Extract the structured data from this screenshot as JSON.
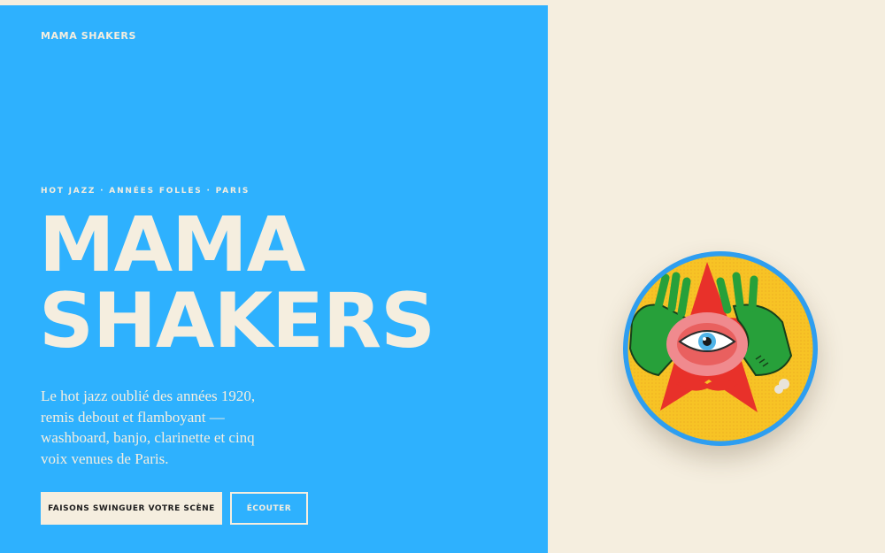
{
  "site": {
    "brand": "MAMA SHAKERS"
  },
  "hero": {
    "tagline": "HOT JAZZ · ANNÉES FOLLES · PARIS",
    "headline_line1": "MAMA",
    "headline_line2": "SHAKERS",
    "lead": "Le hot jazz oublié des années 1920, remis debout et flamboyant — washboard, banjo, clarinette et cinq voix venues de Paris.",
    "primary_cta": "FAISONS SWINGUER VOTRE SCÈNE",
    "secondary_cta": "ÉCOUTER"
  },
  "artwork": {
    "icon": "eye-in-hands-star-illustration"
  },
  "colors": {
    "panel_blue": "#2eb1fe",
    "cream": "#f5eedf",
    "dark_text": "#1c1c1c",
    "star_red": "#e8312a",
    "sun_yellow": "#f7c325",
    "hand_green": "#27a03a"
  }
}
